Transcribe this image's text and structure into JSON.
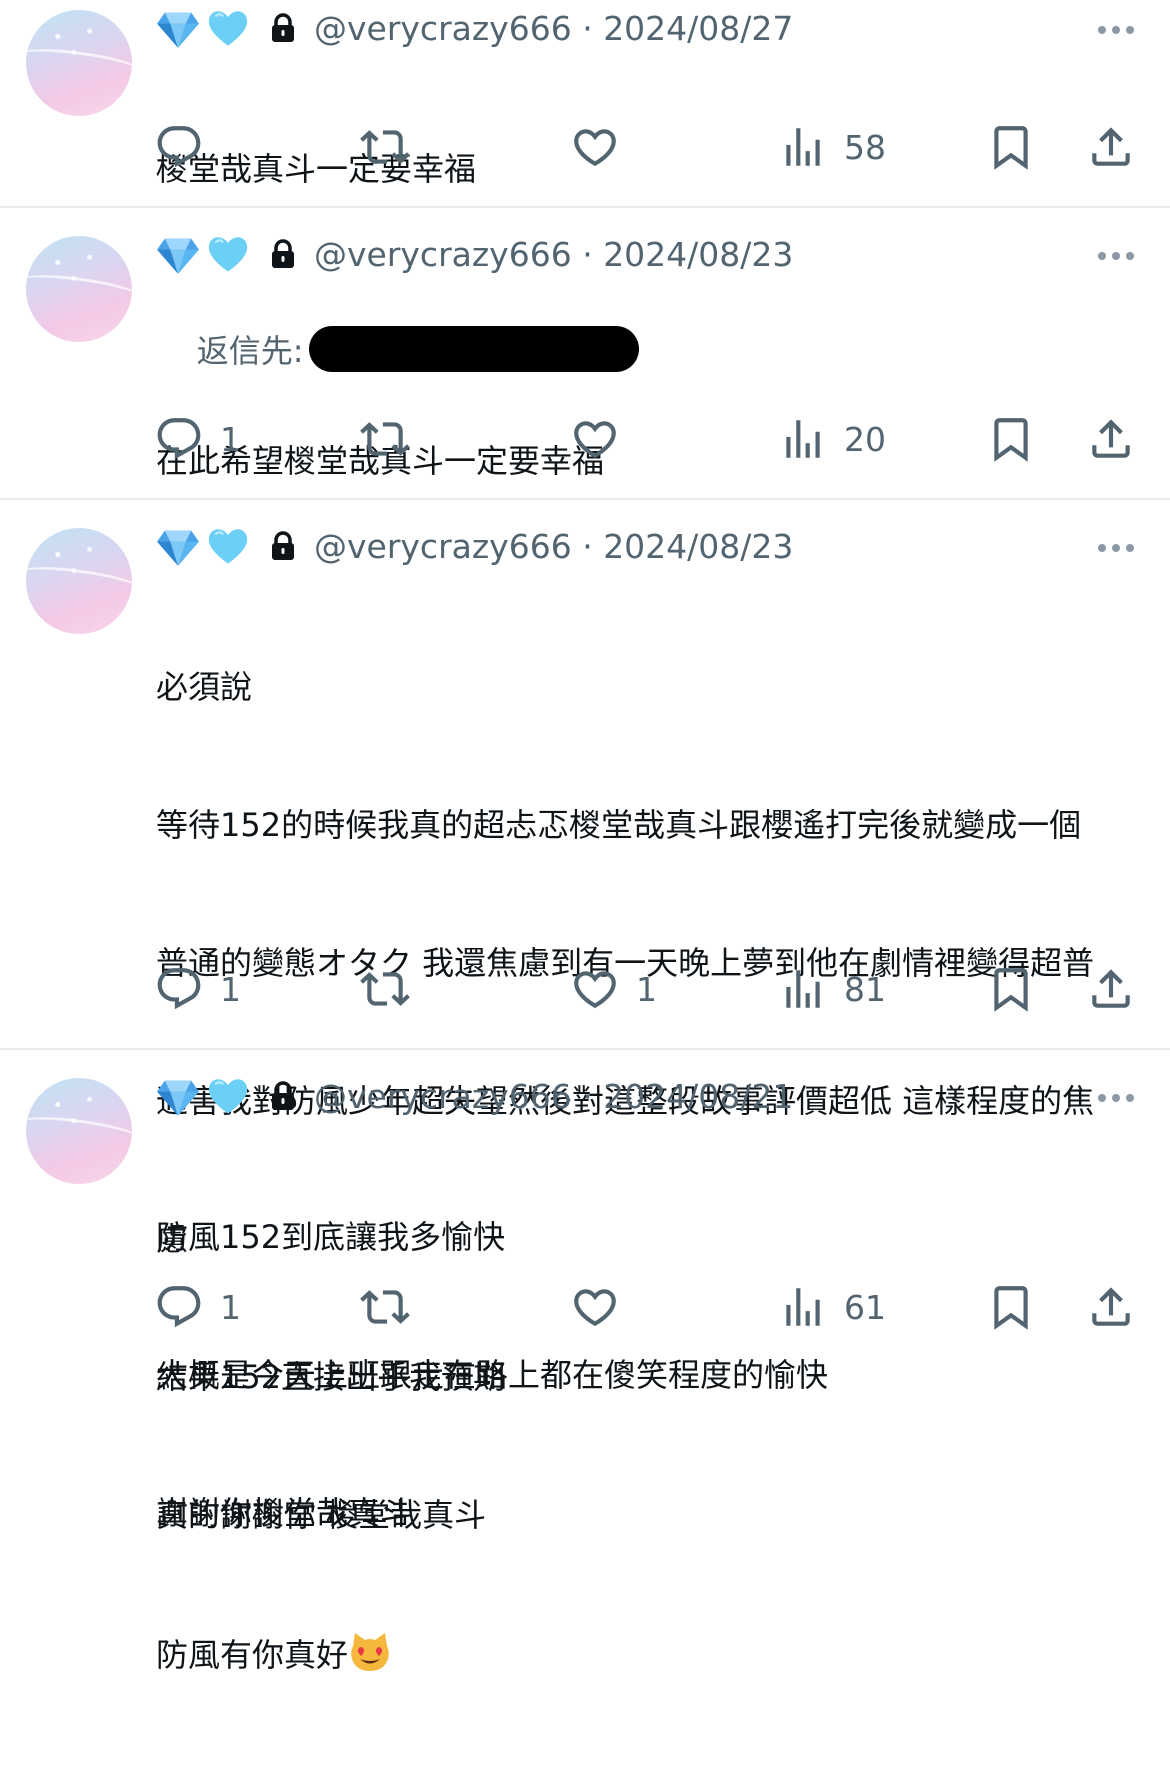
{
  "tweets": [
    {
      "handle": "@verycrazy666",
      "date": "2024/08/27",
      "reply_label": "",
      "lines": [
        "椶堂哉真斗一定要幸福"
      ],
      "replies": "",
      "likes": "",
      "views": "58"
    },
    {
      "handle": "@verycrazy666",
      "date": "2024/08/23",
      "reply_label": "返信先:",
      "lines": [
        "在此希望椶堂哉真斗一定要幸福"
      ],
      "replies": "1",
      "likes": "",
      "views": "20"
    },
    {
      "handle": "@verycrazy666",
      "date": "2024/08/23",
      "reply_label": "",
      "lines": [
        "必須說",
        "等待152的時候我真的超忐忑椶堂哉真斗跟櫻遙打完後就變成一個",
        "普通的變態オタク 我還焦慮到有一天晚上夢到他在劇情裡變得超普",
        "通害我對防風少年超失望然後對這整段故事評價超低 這樣程度的焦",
        "慮",
        "結果152直接出乎我預期",
        "真的謝謝你 椶堂哉真斗",
        "防風有你真好"
      ],
      "replies": "1",
      "likes": "1",
      "views": "81"
    },
    {
      "handle": "@verycrazy666",
      "date": "2024/08/21",
      "reply_label": "",
      "lines": [
        "防風152到底讓我多愉快",
        "大概是今天上班跟走在路上都在傻笑程度的愉快",
        "謝謝你椶堂哉真斗"
      ],
      "replies": "1",
      "likes": "",
      "views": "61"
    }
  ],
  "icons": {
    "badge1": "gem-icon",
    "badge2": "blue-heart-icon",
    "lock": "lock-icon",
    "reply": "reply-icon",
    "retweet": "retweet-icon",
    "like": "heart-icon",
    "views": "views-icon",
    "bookmark": "bookmark-icon",
    "share": "share-icon",
    "emoji": "heart-eyes-cat-icon"
  },
  "colors": {
    "secondary_text": "#536471",
    "divider": "#e9ecee"
  }
}
